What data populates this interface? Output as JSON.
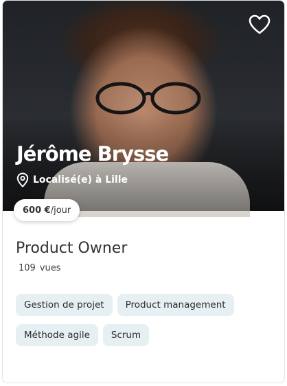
{
  "profile": {
    "name": "Jérôme Brysse",
    "location": "Localisé(e) à Lille",
    "rate_amount": "600 €",
    "rate_unit": "/jour",
    "job_title": "Product Owner",
    "views_count": "109",
    "views_label": "vues"
  },
  "tags": [
    "Gestion de projet",
    "Product management",
    "Méthode agile",
    "Scrum"
  ],
  "icons": {
    "favorite": "heart-icon",
    "location": "location-pin-icon"
  },
  "colors": {
    "tag_background": "#e6f0f2",
    "text_primary": "#333333",
    "overlay_text": "#ffffff"
  }
}
